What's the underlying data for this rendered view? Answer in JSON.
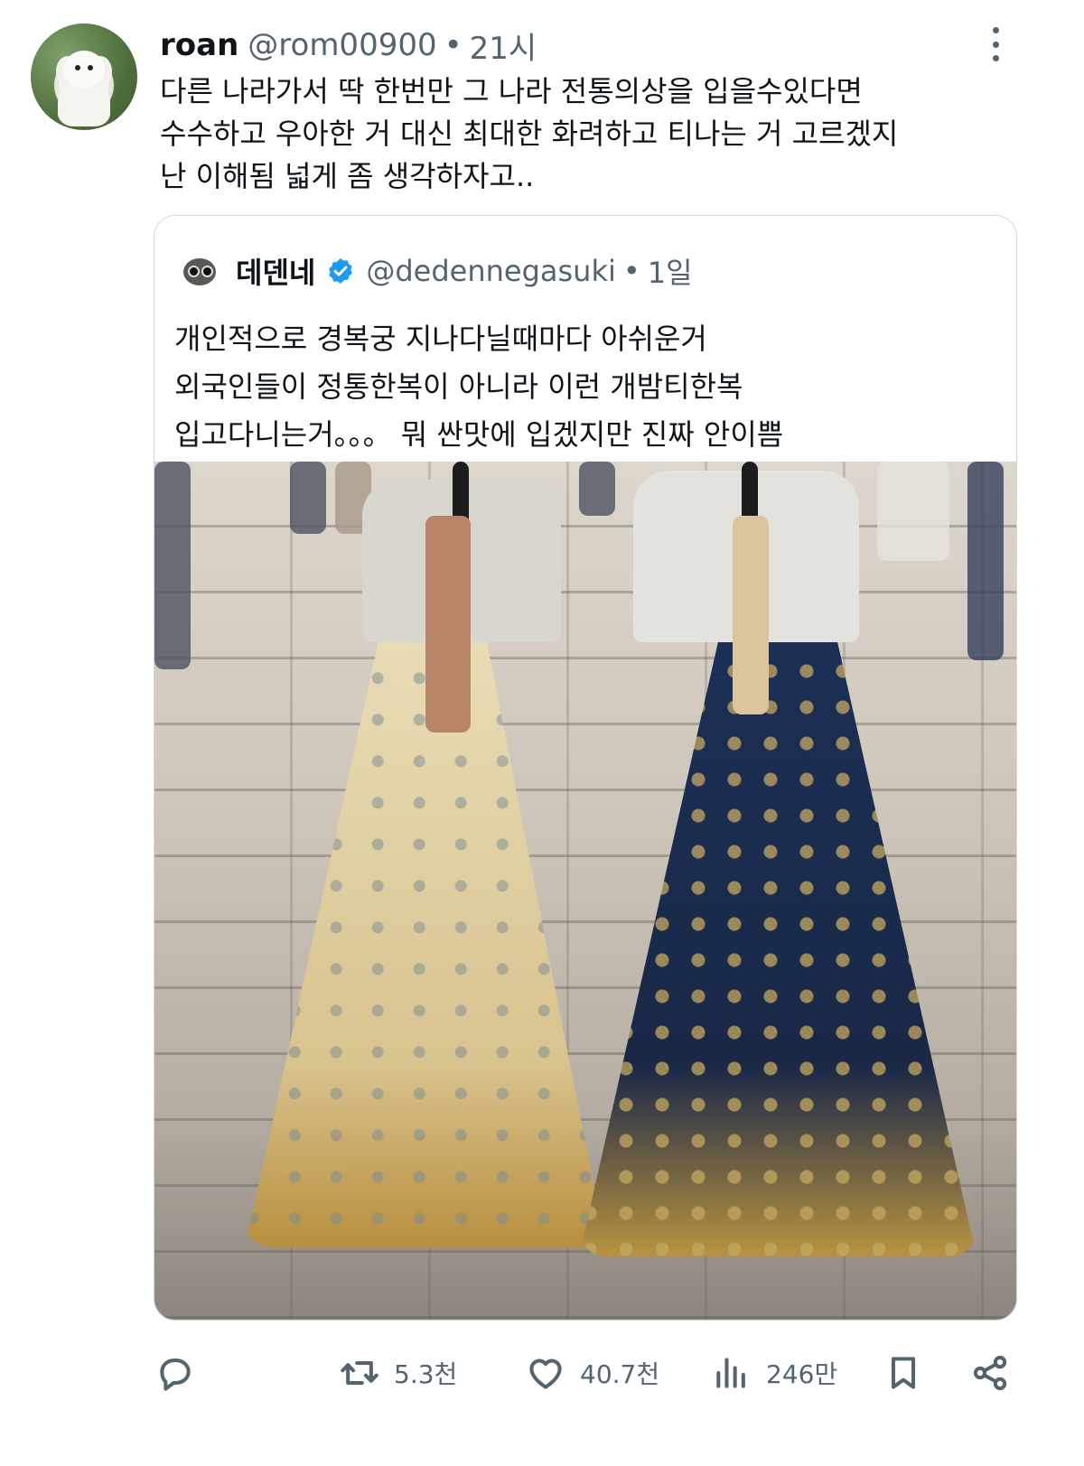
{
  "tweet": {
    "name": "roan",
    "handle": "@rom00900",
    "dot": "•",
    "time": "21시",
    "lines": [
      "다른 나라가서 딱 한번만 그 나라 전통의상을 입을수있다면",
      "수수하고 우아한 거 대신 최대한 화려하고 티나는 거 고르겠지",
      "난 이해됨 넓게 좀 생각하자고.."
    ]
  },
  "quote": {
    "name": "데덴네",
    "handle": "@dedennegasuki",
    "dot": "•",
    "time": "1일",
    "lines": [
      "개인적으로 경복궁 지나다닐때마다 아쉬운거",
      "외국인들이 정통한복이 아니라 이런 개밤티한복",
      "입고다니는거。。。 뭐 싼맛에 입겠지만 진짜 안이쁨"
    ]
  },
  "actions": {
    "reply_count": "",
    "retweet_count": "5.3천",
    "like_count": "40.7천",
    "views_count": "246만"
  },
  "colors": {
    "text": "#0f1419",
    "secondary": "#536471",
    "border": "#cfd9de",
    "verified": "#1d9bf0"
  },
  "icons": [
    "more-icon",
    "verified-icon",
    "reply-icon",
    "retweet-icon",
    "like-icon",
    "views-icon",
    "bookmark-icon",
    "share-icon"
  ]
}
